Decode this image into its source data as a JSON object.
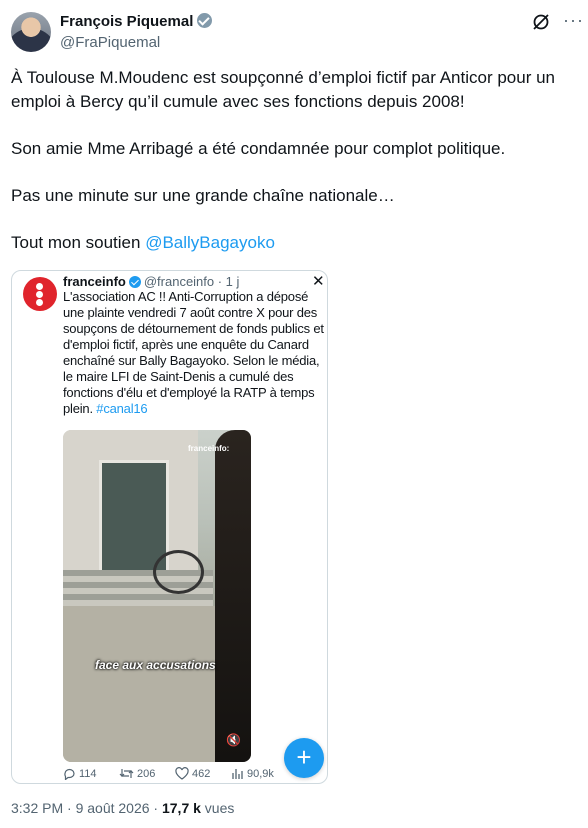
{
  "author": {
    "name": "François Piquemal",
    "handle": "@FraPiquemal"
  },
  "tweet": {
    "paragraphs": [
      "À Toulouse M.Moudenc est soupçonné d’emploi fictif par Anticor pour un emploi à Bercy qu’il cumule avec ses fonctions depuis 2008!",
      "Son amie Mme Arribagé a été condamnée pour complot politique.",
      "Pas une minute sur une grande chaîne nationale…"
    ],
    "last_prefix": "Tout mon soutien ",
    "mention": "@BallyBagayoko"
  },
  "quoted": {
    "name": "franceinfo",
    "meta": "@franceinfo · 1 j",
    "close_glyph": "✕",
    "text": "L'association AC !! Anti-Corruption a déposé une plainte vendredi 7 août contre X pour des soupçons de détournement de fonds publics et d'emploi fictif, après une enquête du Canard enchaîné sur Bally Bagayoko. Selon le média, le maire LFI de Saint-Denis a cumulé des fonctions d'élu et d'employé la RATP à temps plein. ",
    "hashtag": "#canal16",
    "video": {
      "watermark": "franceinfo:",
      "caption": "face aux accusations"
    },
    "stats": {
      "replies": "114",
      "reposts": "206",
      "likes": "462",
      "views": "90,9k"
    }
  },
  "fab_label": "+",
  "footer": {
    "time": "3:32 PM · 9 août 2026 · ",
    "views_count": "17,7 k",
    "views_label": " vues"
  },
  "colors": {
    "accent": "#1d9bf0",
    "text": "#0f1419",
    "muted": "#536471",
    "franceinfo_red": "#e0242c"
  },
  "icons": [
    "verified-badge-icon",
    "grok-icon",
    "more-icon",
    "franceinfo-logo",
    "reply-icon",
    "repost-icon",
    "like-icon",
    "views-icon",
    "mute-icon",
    "compose-icon"
  ]
}
